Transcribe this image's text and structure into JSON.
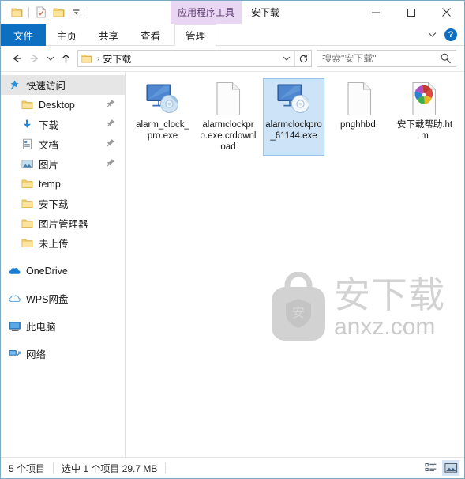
{
  "window": {
    "title": "安下载",
    "contextual_tab": "应用程序工具",
    "controls": {
      "minimize": "minimize-icon",
      "maximize": "maximize-icon",
      "close": "close-icon"
    },
    "quick_access_toolbar": [
      {
        "name": "folder-icon",
        "label": "属性"
      },
      {
        "name": "properties-icon",
        "label": "属性"
      },
      {
        "name": "new-folder-icon",
        "label": "新建文件夹"
      },
      {
        "name": "chevron-down-icon",
        "label": "自定义快速访问工具栏"
      }
    ]
  },
  "ribbon": {
    "tabs": [
      {
        "label": "文件",
        "selected": true
      },
      {
        "label": "主页",
        "selected": false
      },
      {
        "label": "共享",
        "selected": false
      },
      {
        "label": "查看",
        "selected": false
      }
    ],
    "contextual_tab_label": "管理",
    "expand_icon": "chevron-down-icon",
    "help_label": "?"
  },
  "address": {
    "back_icon": "arrow-left-icon",
    "forward_icon": "arrow-right-icon",
    "recent_icon": "chevron-down-icon",
    "up_icon": "arrow-up-icon",
    "folder_icon": "folder-icon",
    "separator": "›",
    "path": "安下载",
    "dropdown_icon": "chevron-down-icon",
    "refresh_icon": "refresh-icon"
  },
  "search": {
    "placeholder": "搜索\"安下载\"",
    "value": "",
    "icon": "search-icon"
  },
  "sidebar": {
    "items": [
      {
        "label": "快速访问",
        "icon": "star-pin-icon",
        "selected": true,
        "pinned": false,
        "indent": 1
      },
      {
        "label": "Desktop",
        "icon": "folder-icon",
        "selected": false,
        "pinned": true,
        "indent": 2
      },
      {
        "label": "下载",
        "icon": "download-icon",
        "selected": false,
        "pinned": true,
        "indent": 2
      },
      {
        "label": "文档",
        "icon": "documents-icon",
        "selected": false,
        "pinned": true,
        "indent": 2
      },
      {
        "label": "图片",
        "icon": "pictures-icon",
        "selected": false,
        "pinned": true,
        "indent": 2
      },
      {
        "label": "temp",
        "icon": "folder-icon",
        "selected": false,
        "pinned": false,
        "indent": 2
      },
      {
        "label": "安下载",
        "icon": "folder-icon",
        "selected": false,
        "pinned": false,
        "indent": 2
      },
      {
        "label": "图片管理器",
        "icon": "folder-icon",
        "selected": false,
        "pinned": false,
        "indent": 2
      },
      {
        "label": "未上传",
        "icon": "folder-icon",
        "selected": false,
        "pinned": false,
        "indent": 2
      }
    ],
    "groups": [
      {
        "label": "OneDrive",
        "icon": "onedrive-cloud-icon"
      },
      {
        "label": "WPS网盘",
        "icon": "cloud-outline-icon"
      },
      {
        "label": "此电脑",
        "icon": "this-pc-icon"
      },
      {
        "label": "网络",
        "icon": "network-icon"
      }
    ]
  },
  "files": [
    {
      "name": "alarm_clock_pro.exe",
      "icon": "exe-monitor-disc-icon",
      "selected": false
    },
    {
      "name": "alarmclockpro.exe.crdownload",
      "icon": "blank-document-icon",
      "selected": false
    },
    {
      "name": "alarmclockpro_61144.exe",
      "icon": "exe-monitor-disc-icon",
      "selected": true
    },
    {
      "name": "pnghhbd.",
      "icon": "blank-document-icon",
      "selected": false
    },
    {
      "name": "安下载帮助.htm",
      "icon": "chrome-html-icon",
      "selected": false
    }
  ],
  "watermark": {
    "brand": "安下载",
    "domain": "anxz.com",
    "shield_glyph": "安",
    "color": "#d2d2d2"
  },
  "statusbar": {
    "item_count": "5 个项目",
    "selection": "选中 1 个项目  29.7 MB",
    "views": [
      {
        "name": "details-view-button",
        "active": false
      },
      {
        "name": "large-icons-view-button",
        "active": true
      }
    ]
  },
  "colors": {
    "accent": "#0d6fc1",
    "contextual_tab": "#e9d6f2",
    "selection": "#cde3f7",
    "folder": "#f8d775",
    "window_border": "#7ea7c4"
  }
}
